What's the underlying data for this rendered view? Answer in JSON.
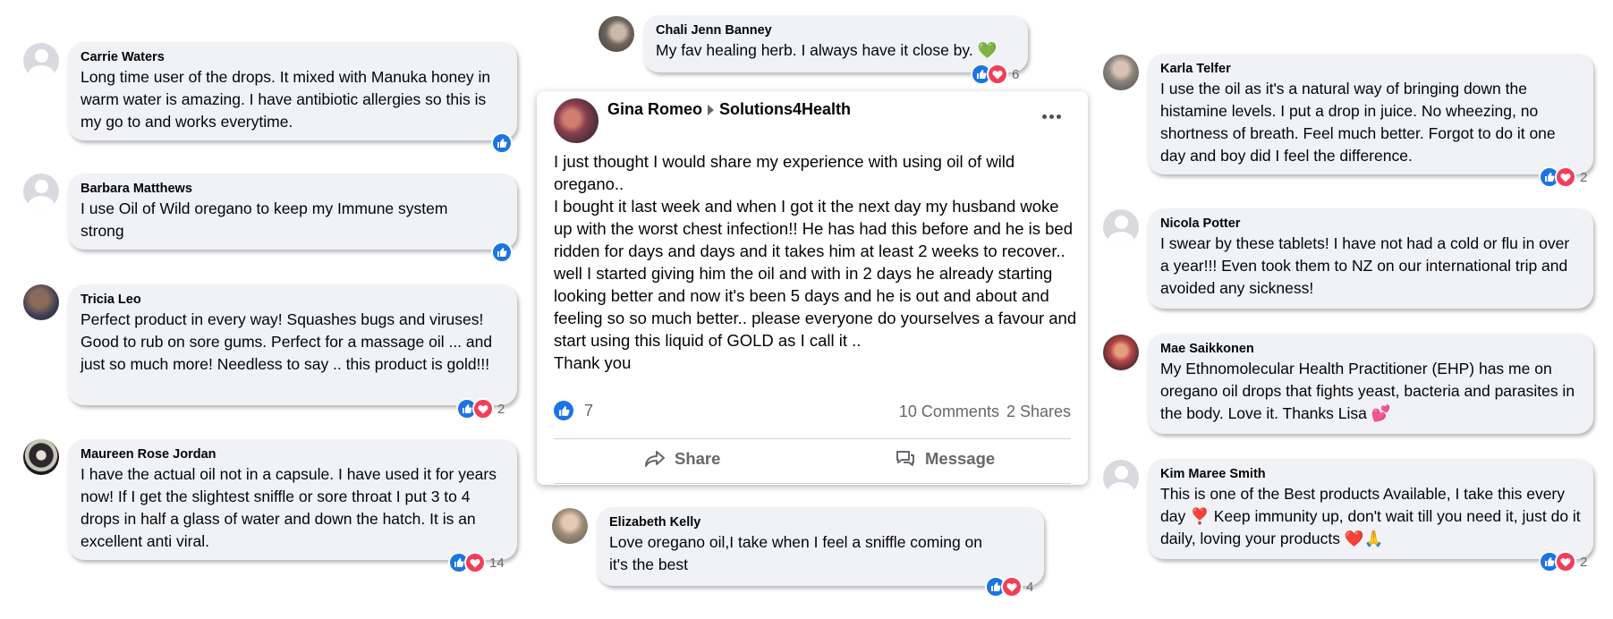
{
  "comments": [
    {
      "name": "Carrie Waters",
      "text": "Long time user of the drops. It mixed with Manuka honey in warm water is amazing. I have antibiotic allergies so this is my go to and works everytime.",
      "reactions": {
        "types": [
          "like"
        ],
        "count": ""
      }
    },
    {
      "name": "Barbara Matthews",
      "text": "I use Oil of Wild oregano to keep my Immune system strong",
      "reactions": {
        "types": [
          "like"
        ],
        "count": ""
      }
    },
    {
      "name": "Tricia Leo",
      "text": "Perfect product in every way! Squashes bugs and viruses! Good to rub on sore gums. Perfect for a massage oil ... and just so much more! Needless to say .. this product is gold!!!",
      "reactions": {
        "types": [
          "like",
          "love"
        ],
        "count": "2"
      }
    },
    {
      "name": "Maureen Rose Jordan",
      "text": "I have the actual oil not in a capsule. I have used it for years now! If I get the slightest sniffle or sore throat I put 3 to 4 drops in half a glass of water and down the hatch. It is an excellent anti viral.",
      "reactions": {
        "types": [
          "like",
          "love"
        ],
        "count": "14"
      }
    },
    {
      "name": "Chali Jenn Banney",
      "text": "My fav healing herb. I always have it close by. 💚",
      "reactions": {
        "types": [
          "like",
          "love"
        ],
        "count": "6"
      }
    },
    {
      "name": "Elizabeth Kelly",
      "text": "Love oregano oil,I take when I feel a sniffle coming on it's the best",
      "reactions": {
        "types": [
          "like",
          "love"
        ],
        "count": "4"
      }
    },
    {
      "name": "Karla Telfer",
      "text": "I use the oil as it's a natural way of bringing down the histamine levels. I put a drop in juice. No wheezing, no shortness of breath. Feel much better. Forgot to do it one day and boy did I feel the difference.",
      "reactions": {
        "types": [
          "like",
          "love"
        ],
        "count": "2"
      }
    },
    {
      "name": "Nicola Potter",
      "text": "I swear by these tablets! I have not had a cold or flu in over a year!!! Even took them to NZ on our international trip and avoided any sickness!",
      "reactions": {
        "types": [],
        "count": ""
      }
    },
    {
      "name": "Mae Saikkonen",
      "text": "My Ethnomolecular Health Practitioner (EHP) has me on oregano oil drops that fights yeast, bacteria and parasites in the body. Love it. Thanks Lisa 💕",
      "reactions": {
        "types": [],
        "count": ""
      }
    },
    {
      "name": "Kim Maree Smith",
      "text": "This is one of the Best products Available, I take this every day ❣️ Keep immunity up, don't wait till you need it, just do it daily, loving your products ❤️🙏",
      "reactions": {
        "types": [
          "like",
          "love"
        ],
        "count": "2"
      }
    }
  ],
  "post": {
    "author": "Gina Romeo",
    "group": "Solutions4Health",
    "menu_icon": "more-dots-icon",
    "body": "I just thought I would share my experience with using oil of wild oregano..\nI bought it last week and when I got it the next day my husband woke up with the worst chest infection!! He has had this before and he is bed ridden for days and days and it takes him at least 2 weeks to recover.. well I started giving him the oil and with in 2 days he already starting looking better and now it's been 5 days and he is out and about and feeling so so much better.. please everyone do yourselves a favour and start using this liquid of GOLD as I call it ..\nThank you",
    "like_count": "7",
    "comments_label": "10 Comments",
    "shares_label": "2 Shares",
    "share_button": "Share",
    "message_button": "Message"
  },
  "colors": {
    "like": "#1b74e4",
    "love": "#f33e58",
    "bubble": "#f0f2f5",
    "meta": "#65676b"
  }
}
